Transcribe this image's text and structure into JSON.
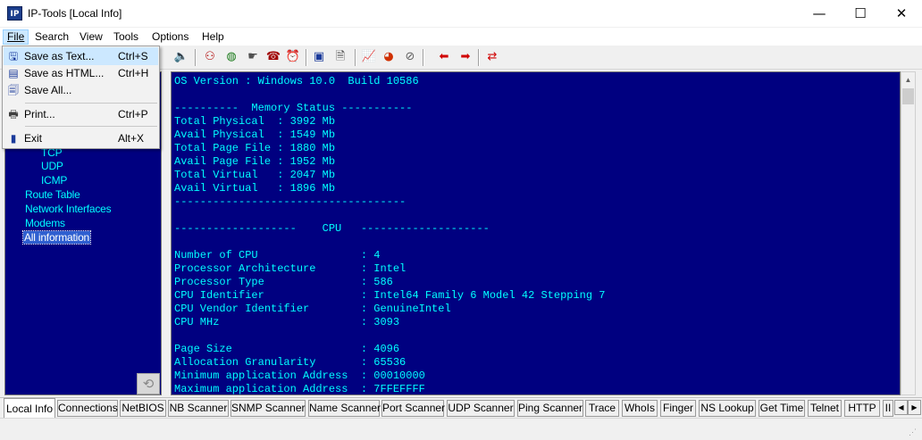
{
  "window": {
    "title": "IP-Tools [Local Info]",
    "icon": "IP",
    "min_glyph": "—",
    "max_glyph": "☐",
    "close_glyph": "✕"
  },
  "menu": [
    "File",
    "Search",
    "View",
    "Tools",
    "Options",
    "Help"
  ],
  "file_menu": [
    {
      "label": "Save as Text...",
      "shortcut": "Ctrl+S",
      "icon": "save-text-icon",
      "glyph": "🖫"
    },
    {
      "label": "Save as HTML...",
      "shortcut": "Ctrl+H",
      "icon": "save-html-icon",
      "glyph": "▤"
    },
    {
      "label": "Save All...",
      "shortcut": "",
      "icon": "save-all-icon",
      "glyph": "🗐"
    },
    {
      "label": "Print...",
      "shortcut": "Ctrl+P",
      "icon": "printer-icon",
      "glyph": "🖶"
    },
    {
      "label": "Exit",
      "shortcut": "Alt+X",
      "icon": "exit-door-icon",
      "glyph": "▮"
    }
  ],
  "tree": [
    "TCP",
    "UDP",
    "ICMP",
    "Route Table",
    "Network Interfaces",
    "Modems",
    "All information"
  ],
  "content_lines": [
    "OS Version : Windows 10.0  Build 10586",
    "",
    "----------  Memory Status -----------",
    "Total Physical  : 3992 Mb",
    "Avail Physical  : 1549 Mb",
    "Total Page File : 1880 Mb",
    "Avail Page File : 1952 Mb",
    "Total Virtual   : 2047 Mb",
    "Avail Virtual   : 1896 Mb",
    "------------------------------------",
    "",
    "-------------------    CPU   --------------------",
    "",
    "Number of CPU                : 4",
    "Processor Architecture       : Intel",
    "Processor Type               : 586",
    "CPU Identifier               : Intel64 Family 6 Model 42 Stepping 7",
    "CPU Vendor Identifier        : GenuineIntel",
    "CPU MHz                      : 3093",
    "",
    "Page Size                    : 4096",
    "Allocation Granularity       : 65536",
    "Minimum application Address  : 00010000",
    "Maximum application Address  : 7FFEFFFF"
  ],
  "tabs": [
    "Local Info",
    "Connections",
    "NetBIOS",
    "NB Scanner",
    "SNMP Scanner",
    "Name Scanner",
    "Port Scanner",
    "UDP Scanner",
    "Ping Scanner",
    "Trace",
    "WhoIs",
    "Finger",
    "NS Lookup",
    "Get Time",
    "Telnet",
    "HTTP",
    "II"
  ],
  "tab_scroll": {
    "left": "◀",
    "right": "▶"
  },
  "colors": {
    "panel_bg": "#000080",
    "panel_text": "#00ffff",
    "menu_highlight": "#cce8ff"
  },
  "toolbar_icons": [
    {
      "name": "speaker-icon",
      "glyph": "🔈",
      "color": "#707000"
    },
    {
      "name": "network-icon",
      "glyph": "⚇",
      "color": "#b00000"
    },
    {
      "name": "globe-icon",
      "glyph": "◍",
      "color": "#1a7a1a"
    },
    {
      "name": "hand-pointer-icon",
      "glyph": "☛",
      "color": "#505050"
    },
    {
      "name": "phone-icon",
      "glyph": "☎",
      "color": "#a00000"
    },
    {
      "name": "alarm-clock-icon",
      "glyph": "⏰",
      "color": "#c00000"
    },
    {
      "name": "computers-icon",
      "glyph": "▣",
      "color": "#1a3a9a"
    },
    {
      "name": "document-icon",
      "glyph": "🗎",
      "color": "#404040"
    },
    {
      "name": "chart-icon",
      "glyph": "📈",
      "color": "#c00000"
    },
    {
      "name": "pie-chart-icon",
      "glyph": "◕",
      "color": "#d03000"
    },
    {
      "name": "satellite-dish-icon",
      "glyph": "⊘",
      "color": "#606060"
    },
    {
      "name": "arrow-left-icon",
      "glyph": "⬅",
      "color": "#d00000"
    },
    {
      "name": "arrow-right-icon",
      "glyph": "➡",
      "color": "#d00000"
    },
    {
      "name": "swap-arrows-icon",
      "glyph": "⇄",
      "color": "#d00000"
    }
  ],
  "refresh_glyph": "⟲",
  "scroll_up_glyph": "▲",
  "grip_glyph": "⋰"
}
